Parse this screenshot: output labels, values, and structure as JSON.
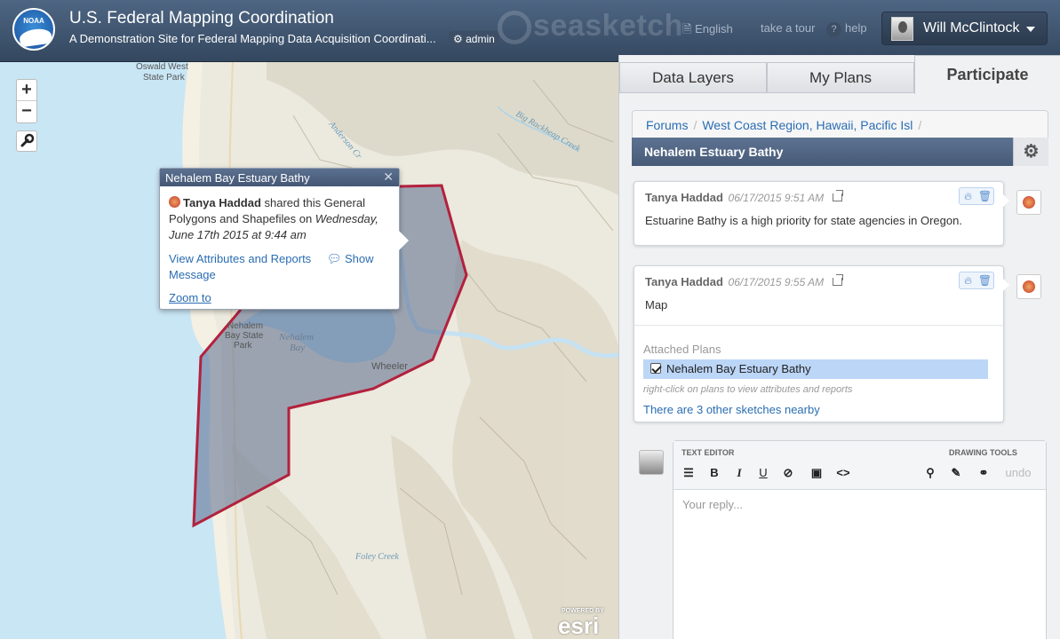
{
  "header": {
    "logo_text": "NOAA",
    "title": "U.S. Federal Mapping Coordination",
    "subtitle": "A Demonstration Site for Federal Mapping Data Acquisition Coordinati...",
    "admin_label": "admin",
    "brand": "seasketch",
    "language": "English",
    "tour": "take a tour",
    "help": "help",
    "user_name": "Will McClintock"
  },
  "map": {
    "zoom_in": "+",
    "zoom_out": "−",
    "labels": {
      "park": "Oswald West\nState Park",
      "nehalem_park": "Nehalem\nBay State\nPark",
      "nehalem_bay": "Nehalem\nBay",
      "wheeler": "Wheeler",
      "big_creek": "Big Rackheap Creek",
      "foley": "Foley Creek",
      "anderson": "Anderson Cr",
      "river": "Nehalem River"
    },
    "popup": {
      "title": "Nehalem Bay Estuary Bathy",
      "author": "Tanya Haddad",
      "text_pre": " shared this General Polygons and Shapefiles on ",
      "date": "Wednesday, June 17th 2015 at 9:44 am",
      "view_link": "View Attributes and Reports",
      "show_link": "Show Message",
      "zoom_link": "Zoom to"
    },
    "esri_powered": "POWERED BY",
    "esri": "esri"
  },
  "panel": {
    "tabs": [
      "Data Layers",
      "My Plans",
      "Participate"
    ],
    "breadcrumb": [
      "Forums",
      "West Coast Region, Hawaii, Pacific Isl"
    ],
    "topic_title": "Nehalem Estuary Bathy",
    "posts": [
      {
        "author": "Tanya Haddad",
        "date": "06/17/2015 9:51 AM",
        "text": "Estuarine Bathy is a high priority for state agencies in Oregon."
      },
      {
        "author": "Tanya Haddad",
        "date": "06/17/2015 9:55 AM",
        "text": "Map",
        "attached_label": "Attached Plans",
        "attached_item": "Nehalem Bay Estuary Bathy",
        "hint": "right-click on plans to view attributes and reports",
        "nearby_link": "There are 3 other sketches nearby"
      }
    ],
    "editor": {
      "text_editor_label": "TEXT EDITOR",
      "drawing_tools_label": "DRAWING TOOLS",
      "undo": "undo",
      "placeholder": "Your reply..."
    }
  }
}
